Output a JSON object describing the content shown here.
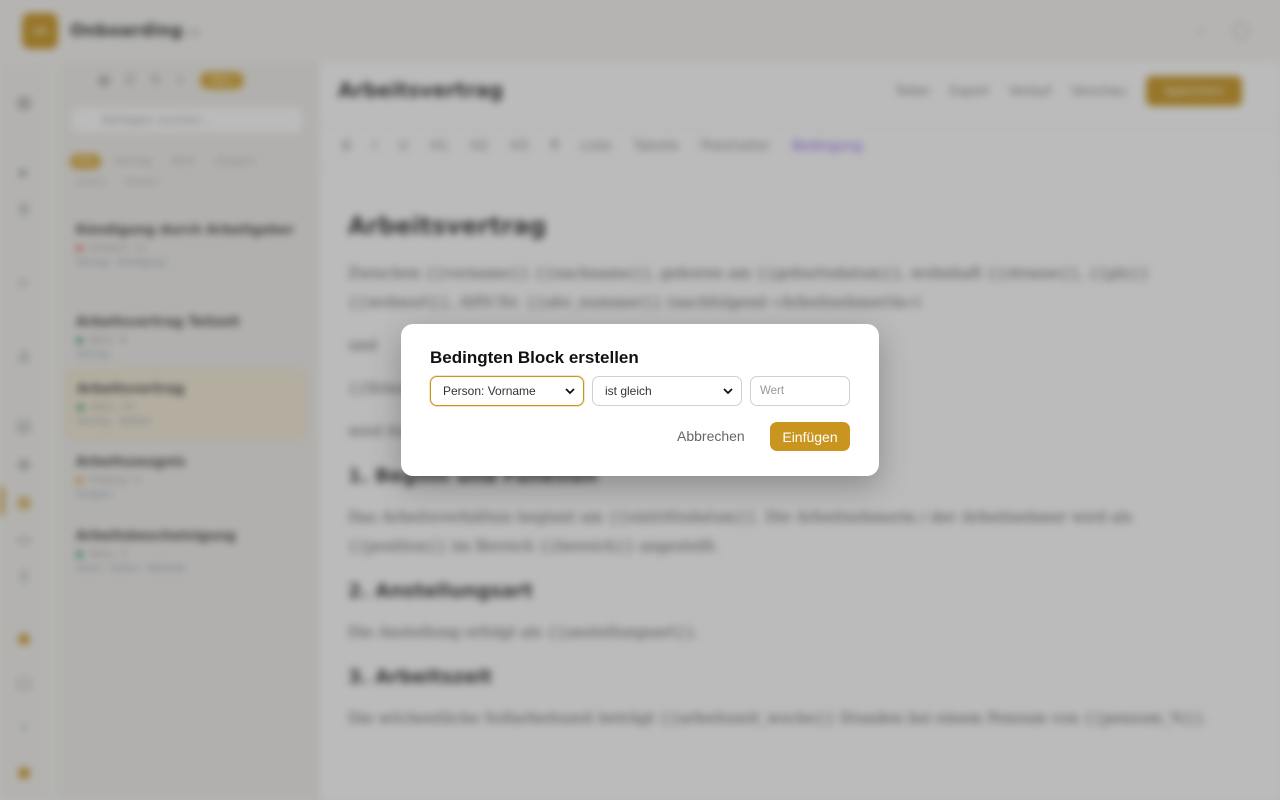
{
  "app": {
    "logo_text": "VA",
    "title": "Onboarding",
    "version": "v1"
  },
  "list": {
    "new_button": "Neu",
    "search_placeholder": "Vorlagen suchen...",
    "filters": [
      "Alle",
      "Vertrag",
      "Brief",
      "Zeugnis",
      "Intern",
      "Extern"
    ],
    "docs": [
      {
        "title": "Kündigung durch Arbeitgeber",
        "status": "Entwurf",
        "count": "12",
        "tags": [
          "Vertrag",
          "Kündigung"
        ],
        "dot": "#e06a5a",
        "active": false
      },
      {
        "title": "Arbeitsvertrag Teilzeit",
        "status": "Aktiv",
        "count": "8",
        "tags": [
          "Vertrag"
        ],
        "dot": "#3c9a6e",
        "active": false
      },
      {
        "title": "Arbeitsvertrag",
        "status": "Aktiv",
        "count": "24",
        "tags": [
          "Vertrag",
          "Vollzeit"
        ],
        "dot": "#3c9a6e",
        "active": true
      },
      {
        "title": "Arbeitszeugnis",
        "status": "Prüfung",
        "count": "5",
        "tags": [
          "Zeugnis"
        ],
        "dot": "#d6a52c",
        "active": false
      },
      {
        "title": "Arbeitsbescheinigung",
        "status": "Aktiv",
        "count": "3",
        "tags": [
          "Intern",
          "Extern",
          "Behörde"
        ],
        "dot": "#3c9a6e",
        "active": false
      }
    ]
  },
  "editor": {
    "doc_heading": "Arbeitsvertrag",
    "actions": [
      "Teilen",
      "Export",
      "Verlauf",
      "Vorschau"
    ],
    "save_label": "Speichern",
    "format_tools": [
      "B",
      "I",
      "U",
      "H1",
      "H2",
      "H3",
      "¶",
      "Liste",
      "Tabelle",
      "Platzhalter",
      "Bedingung"
    ],
    "content": {
      "h1": "Arbeitsvertrag",
      "p1": "Zwischen {{vorname}} {{nachname}}, geboren am {{geburtsdatum}}, wohnhaft {{strasse}}, {{plz}} {{wohnort}}, AHV-Nr. {{ahv_nummer}} (nachfolgend «Arbeitnehmer/in»)",
      "p2": "und",
      "p3": "{{firma}}",
      "p4": "wird folgender Arbeitsvertrag abgeschlossen:",
      "h2_1": "1. Beginn und Funktion",
      "p5": "Das Arbeitsverhältnis beginnt am {{eintrittsdatum}}. Die Arbeitnehmerin / der Arbeitnehmer wird als {{position}} im Bereich {{bereich}} angestellt.",
      "h2_2": "2. Anstellungsart",
      "p6": "Die Anstellung erfolgt als {{anstellungsart}}.",
      "h2_3": "3. Arbeitszeit",
      "p7": "Die wöchentliche Sollarbeitszeit beträgt {{arbeitszeit_woche}} Stunden bei einem Pensum von {{pensum_%}}."
    }
  },
  "modal": {
    "title": "Bedingten Block erstellen",
    "field_select": "Person: Vorname",
    "operator_select": "ist gleich",
    "value_placeholder": "Wert",
    "cancel_label": "Abbrechen",
    "insert_label": "Einfügen"
  },
  "colors": {
    "accent": "#c9951f",
    "purple": "#8a5cf0"
  }
}
